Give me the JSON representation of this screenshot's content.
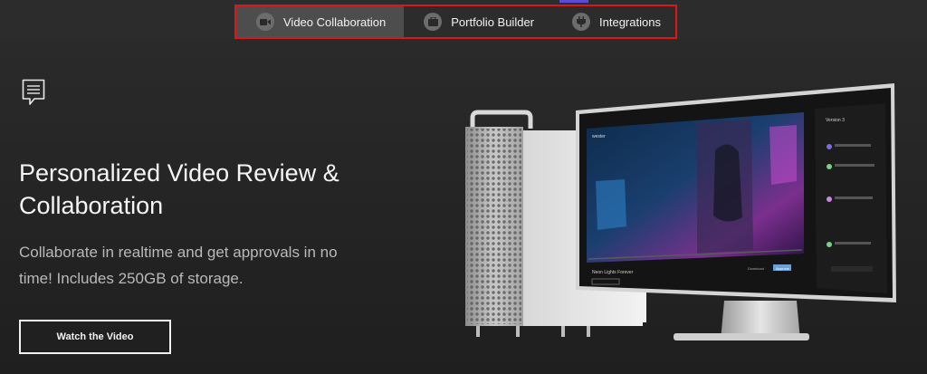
{
  "nav": {
    "tabs": [
      {
        "label": "Video Collaboration",
        "icon": "video-camera-icon",
        "active": true
      },
      {
        "label": "Portfolio Builder",
        "icon": "portfolio-icon",
        "active": false
      },
      {
        "label": "Integrations",
        "icon": "plug-icon",
        "active": false
      }
    ]
  },
  "hero": {
    "icon": "document-comment-icon",
    "title": "Personalized Video Review & Collaboration",
    "subtitle": "Collaborate in realtime and get approvals in no time! Includes 250GB of storage.",
    "cta_label": "Watch the Video"
  },
  "device": {
    "app_name": "wester",
    "video_title": "Neon Lights Forever",
    "side_panel_title": "Version 3",
    "download_label": "Download",
    "approve_label": "Approve"
  },
  "colors": {
    "accent": "#5b4bd6",
    "highlight_border": "#e01616",
    "active_tab": "#4d4d4d"
  }
}
